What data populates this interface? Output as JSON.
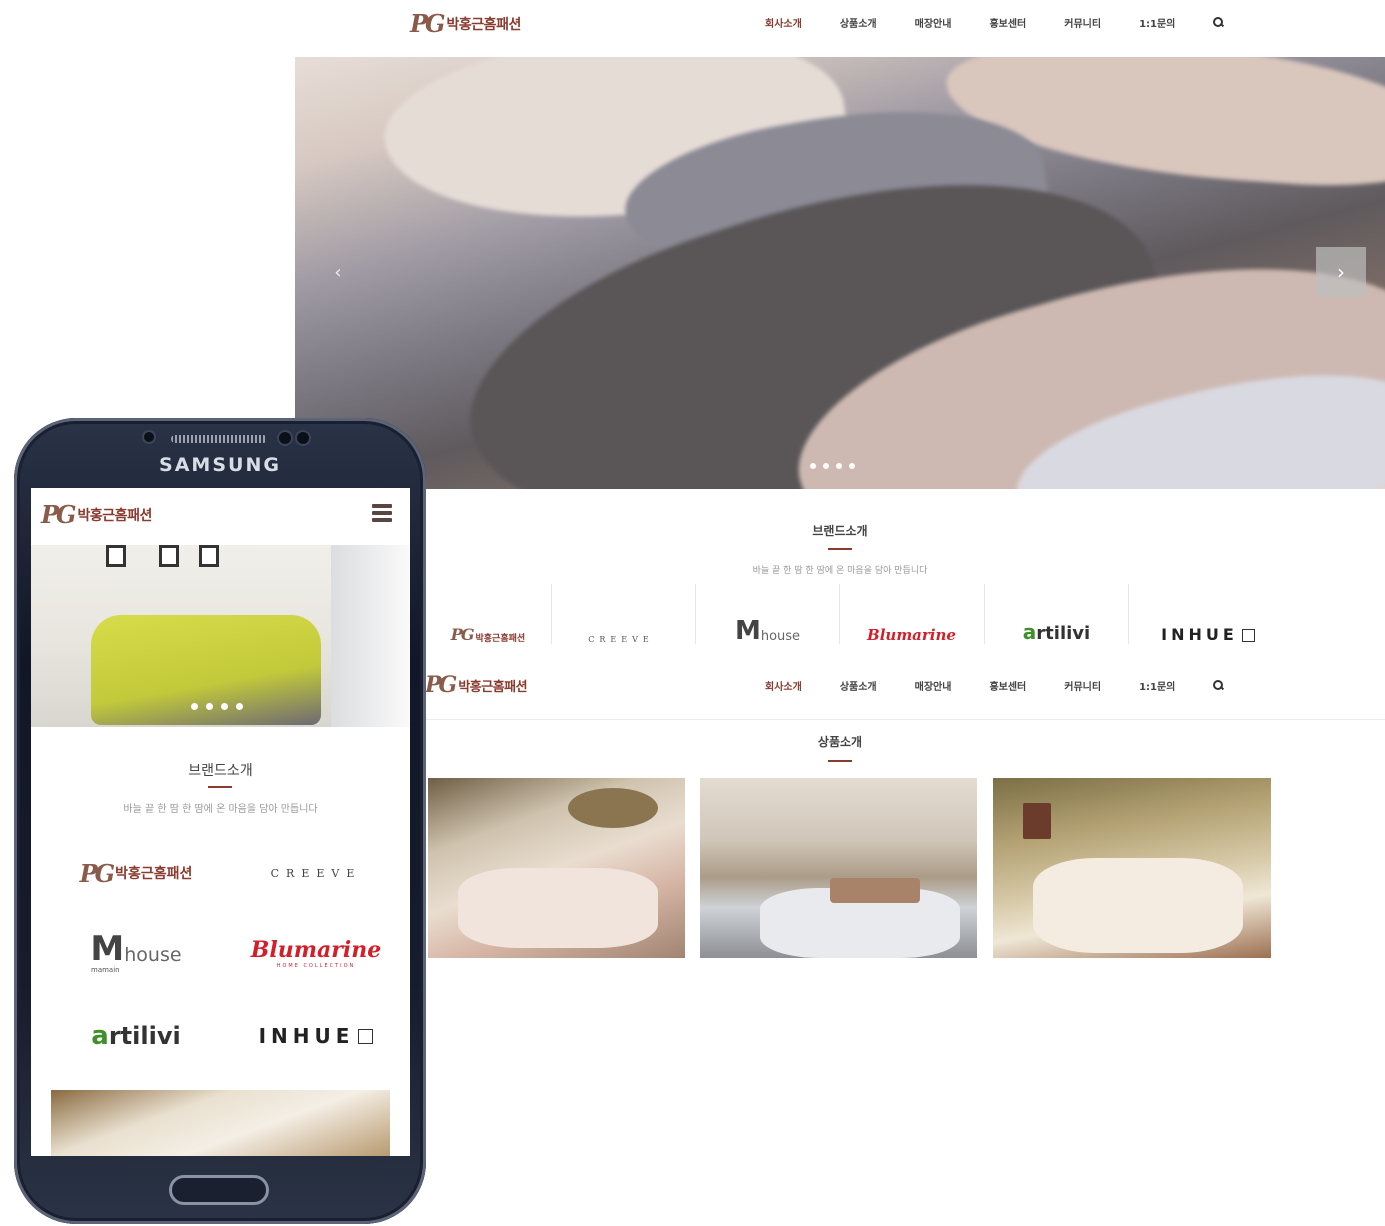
{
  "site": {
    "logo_mark": "PG",
    "logo_text": "박홍근홈패션"
  },
  "nav": {
    "items": [
      "회사소개",
      "상품소개",
      "매장안내",
      "홍보센터",
      "커뮤니티",
      "1:1문의"
    ],
    "active_index": 0,
    "search_icon": "search-icon"
  },
  "hero": {
    "prev_symbol": "‹",
    "next_symbol": "›",
    "slide_count": 4
  },
  "brand_section": {
    "title": "브랜드소개",
    "subtitle": "바늘 끝 한 땀 한 땀에 온 마음을 담아 만듭니다",
    "brands": [
      {
        "name": "박홍근홈패션",
        "mark": "PG"
      },
      {
        "name": "CREEVE"
      },
      {
        "name": "house",
        "mark": "M",
        "sub": "mamain"
      },
      {
        "name": "Blumarine",
        "sub": "HOME COLLECTION"
      },
      {
        "name": "rtilivi",
        "mark": "a"
      },
      {
        "name": "INHUE"
      }
    ]
  },
  "product_section": {
    "title": "상품소개"
  },
  "phone": {
    "brand": "SAMSUNG",
    "menu_icon": "hamburger-menu-icon"
  },
  "colors": {
    "accent": "#8a3b2f",
    "blumarine_red": "#d41f2a",
    "artilivi_green": "#3f8f2b"
  }
}
